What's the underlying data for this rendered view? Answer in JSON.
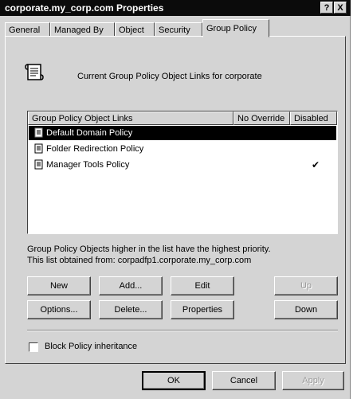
{
  "window": {
    "title": "corporate.my_corp.com Properties",
    "help_label": "?",
    "close_label": "X"
  },
  "tabs": [
    {
      "label": "General"
    },
    {
      "label": "Managed By"
    },
    {
      "label": "Object"
    },
    {
      "label": "Security"
    },
    {
      "label": "Group Policy",
      "active": true
    }
  ],
  "header": {
    "text": "Current Group Policy Object Links for corporate"
  },
  "list": {
    "columns": [
      "Group Policy Object Links",
      "No Override",
      "Disabled"
    ],
    "rows": [
      {
        "name": "Default Domain Policy",
        "no_override": "",
        "disabled": "",
        "selected": true
      },
      {
        "name": "Folder Redirection Policy",
        "no_override": "",
        "disabled": ""
      },
      {
        "name": "Manager Tools Policy",
        "no_override": "",
        "disabled": "✔"
      }
    ]
  },
  "info": {
    "line1": "Group Policy Objects higher in the list have the highest priority.",
    "line2": "This list obtained from: corpadfp1.corporate.my_corp.com"
  },
  "buttons": {
    "new": "New",
    "add": "Add...",
    "edit": "Edit",
    "up": "Up",
    "options": "Options...",
    "delete": "Delete...",
    "properties": "Properties",
    "down": "Down"
  },
  "block_inheritance": {
    "label": "Block Policy inheritance",
    "checked": false
  },
  "dialog_buttons": {
    "ok": "OK",
    "cancel": "Cancel",
    "apply": "Apply"
  },
  "icons": {
    "policy_icon": "scroll-icon",
    "check": "check-icon"
  }
}
